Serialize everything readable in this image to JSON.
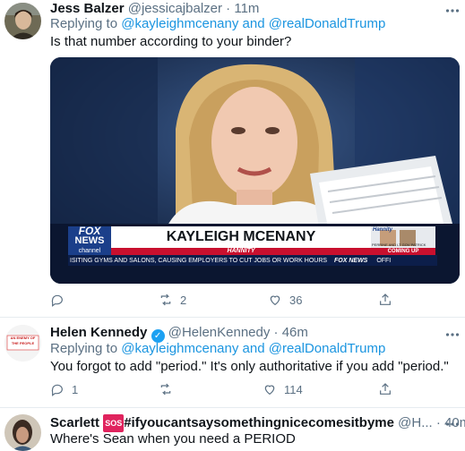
{
  "tweets": [
    {
      "name": "Jess Balzer",
      "handle": "@jessicajbalzer",
      "dot": "·",
      "time": "11m",
      "replying_prefix": "Replying to",
      "replying_to_1": "@kayleighmcenany",
      "replying_and": "and",
      "replying_to_2": "@realDonaldTrump",
      "text": "Is that number according to your binder?",
      "media": {
        "chyron_name": "KAYLEIGH MCENANY",
        "chyron_show": "HANNITY",
        "ticker": "ISITING GYMS AND SALONS, CAUSING EMPLOYERS TO CUT JOBS OR WORK HOURS",
        "ticker_logo": "FOX NEWS",
        "ticker_off": "OFFI",
        "logo_top": "FOX",
        "logo_bottom": "NEWS",
        "logo_channel": "channel",
        "inset_show": "Hannity",
        "inset_caption": "PERRINE AND LT GOV PATRICK",
        "inset_coming": "COMING UP"
      },
      "reply_count": "",
      "retweet_count": "2",
      "like_count": "36"
    },
    {
      "name": "Helen Kennedy",
      "handle": "@HelenKennedy",
      "dot": "·",
      "time": "46m",
      "avatar_text": "AN ENEMY OF THE PEOPLE",
      "replying_prefix": "Replying to",
      "replying_to_1": "@kayleighmcenany",
      "replying_and": "and",
      "replying_to_2": "@realDonaldTrump",
      "text": "You forgot to add \"period.\" It's only authoritative if you add \"period.\"",
      "reply_count": "1",
      "retweet_count": "",
      "like_count": "114"
    },
    {
      "name": "Scarlett",
      "sos": "SOS",
      "hashtag": "#ifyoucantsaysomethingnicecomesitbyme",
      "handle": "@H...",
      "dot": "·",
      "time": "40m",
      "text": "Where's Sean when you need a PERIOD"
    }
  ],
  "icons": {
    "reply": "reply-icon",
    "retweet": "retweet-icon",
    "like": "heart-icon",
    "share": "share-icon",
    "more": "more-icon",
    "verified": "verified-badge-icon"
  },
  "colors": {
    "link": "#1b95e0",
    "muted": "#5b7083",
    "verified": "#1da1f2",
    "fox_red": "#c8102e"
  }
}
